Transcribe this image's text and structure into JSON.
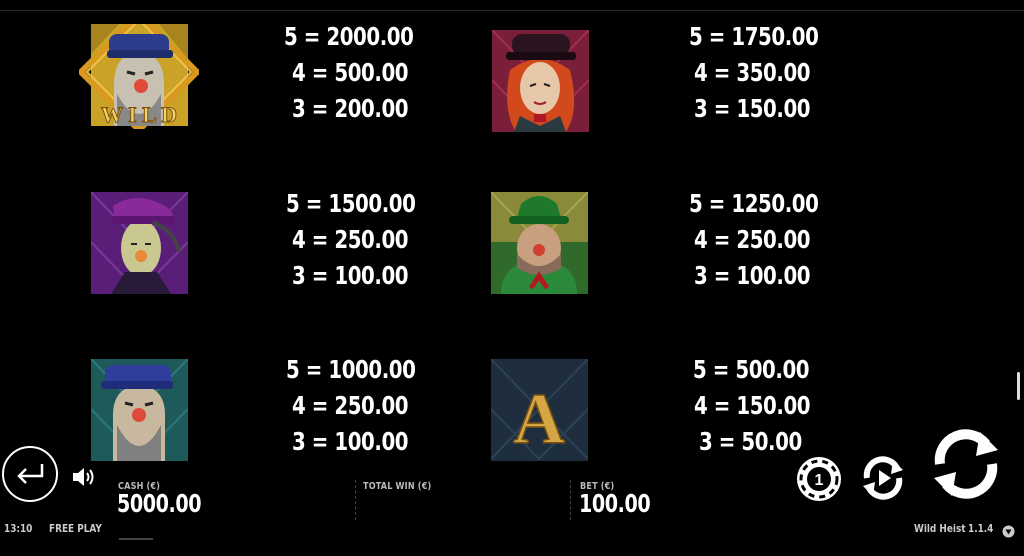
{
  "paytable": [
    {
      "symbol": "wild-heister",
      "badge": "WILD",
      "payouts": [
        "5 = 2000.00",
        "4 = 500.00",
        "3 = 200.00"
      ]
    },
    {
      "symbol": "red-haired-lady",
      "payouts": [
        "5 = 1750.00",
        "4 = 350.00",
        "3 = 150.00"
      ]
    },
    {
      "symbol": "purple-hat-thief",
      "payouts": [
        "5 = 1500.00",
        "4 = 250.00",
        "3 = 100.00"
      ]
    },
    {
      "symbol": "green-bowler-man",
      "payouts": [
        "5 = 1250.00",
        "4 = 250.00",
        "3 = 100.00"
      ]
    },
    {
      "symbol": "blue-cap-heister",
      "payouts": [
        "5 = 1000.00",
        "4 = 250.00",
        "3 = 100.00"
      ]
    },
    {
      "symbol": "letter-a",
      "letter": "A",
      "payouts": [
        "5 = 500.00",
        "4 = 150.00",
        "3 = 50.00"
      ]
    }
  ],
  "bottom_bar": {
    "cash_label": "CASH (€)",
    "cash_value": "5000.00",
    "total_win_label": "TOTAL WIN (€)",
    "total_win_value": "",
    "bet_label": "BET (€)",
    "bet_value": "100.00"
  },
  "footer": {
    "time": "13:10",
    "mode": "FREE PLAY",
    "game_name": "Wild Heist",
    "version": "1.1.4"
  },
  "icons": {
    "back": "back-arrow-icon",
    "sound": "speaker-icon",
    "coin": "poker-chip-icon",
    "autoplay": "autoplay-icon",
    "spin": "spin-icon",
    "info": "info-triangle-icon"
  },
  "colors": {
    "background": "#000000",
    "text": "#ffffff",
    "wild_bg": "#c9a227",
    "lady_bg": "#7a1e3a",
    "purple_bg": "#5a1e78",
    "green_bg": "#2f6a2a",
    "teal_bg": "#1e5a5a",
    "a_bg": "#1e2e3e",
    "gold": "#d4a646"
  }
}
